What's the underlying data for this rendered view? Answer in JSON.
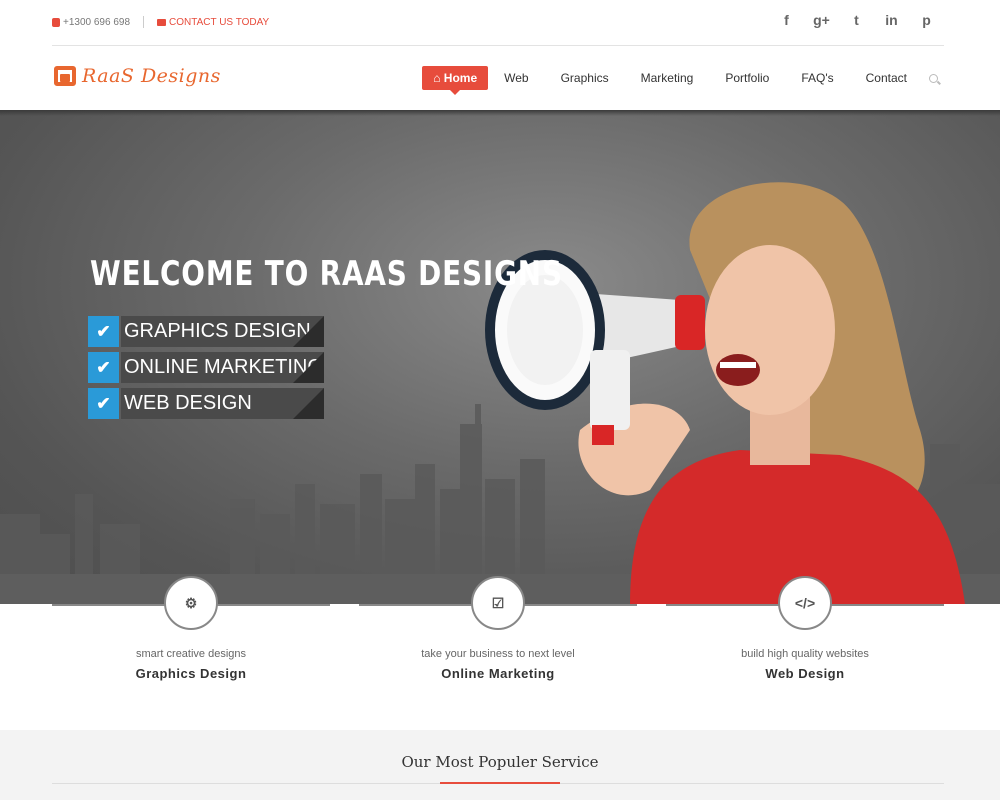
{
  "topbar": {
    "phone": "+1300 696 698",
    "contact_link": "CONTACT US TODAY",
    "socials": [
      {
        "icon": "facebook-icon",
        "glyph": "f"
      },
      {
        "icon": "google-plus-icon",
        "glyph": "g+"
      },
      {
        "icon": "twitter-icon",
        "glyph": "t"
      },
      {
        "icon": "linkedin-icon",
        "glyph": "in"
      },
      {
        "icon": "pinterest-icon",
        "glyph": "p"
      }
    ]
  },
  "header": {
    "logo_text": "RaaS Designs",
    "nav": [
      "Home",
      "Web",
      "Graphics",
      "Marketing",
      "Portfolio",
      "FAQ's",
      "Contact"
    ],
    "active_nav": "Home",
    "home_icon": "home-icon",
    "search_icon": "search-icon"
  },
  "hero": {
    "title": "WELCOME TO RAAS DESIGNS",
    "features": [
      "GRAPHICS DESIGN",
      "ONLINE MARKETING",
      "WEB DESIGN"
    ],
    "check_icon": "check-icon"
  },
  "services": [
    {
      "icon": "gear-icon",
      "glyph": "⚙",
      "subtitle": "smart creative designs",
      "title": "Graphics Design"
    },
    {
      "icon": "checkbox-icon",
      "glyph": "☑",
      "subtitle": "take your business to next level",
      "title": "Online Marketing"
    },
    {
      "icon": "code-icon",
      "glyph": "</>",
      "subtitle": "build high quality websites",
      "title": "Web Design"
    }
  ],
  "popular": {
    "heading": "Our Most Populer Service"
  },
  "colors": {
    "accent": "#e74c3c",
    "logo": "#e8672f",
    "check": "#2a9ad8"
  }
}
